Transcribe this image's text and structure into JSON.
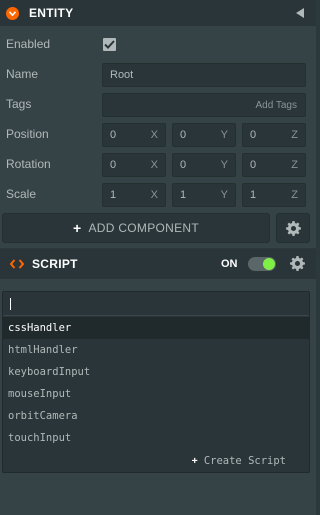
{
  "entity": {
    "title": "ENTITY",
    "enabled_label": "Enabled",
    "name_label": "Name",
    "name_value": "Root",
    "tags_label": "Tags",
    "tags_placeholder": "Add Tags",
    "position_label": "Position",
    "rotation_label": "Rotation",
    "scale_label": "Scale",
    "position": {
      "x": "0",
      "y": "0",
      "z": "0"
    },
    "rotation": {
      "x": "0",
      "y": "0",
      "z": "0"
    },
    "scale": {
      "x": "1",
      "y": "1",
      "z": "1"
    },
    "axes": {
      "x": "X",
      "y": "Y",
      "z": "Z"
    },
    "add_component_label": "ADD COMPONENT"
  },
  "script": {
    "title": "SCRIPT",
    "toggle_label": "ON",
    "search_value": "",
    "items": [
      "cssHandler",
      "htmlHandler",
      "keyboardInput",
      "mouseInput",
      "orbitCamera",
      "touchInput"
    ],
    "create_label": "Create Script"
  },
  "colors": {
    "accent": "#ff6600",
    "toggle_on": "#7fef45"
  },
  "icons": {
    "entity_collapse": "chevron-down-icon",
    "panel_collapse": "triangle-left-icon",
    "checkbox": "check-icon",
    "add": "plus-icon",
    "settings": "gear-icon",
    "script": "code-icon"
  }
}
